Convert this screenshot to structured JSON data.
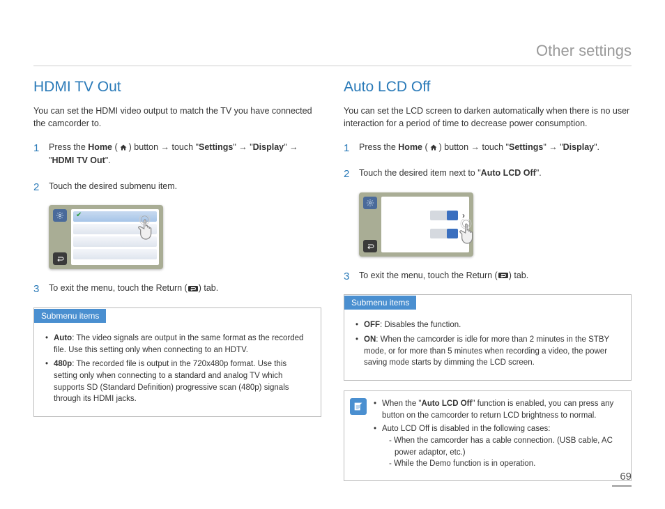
{
  "page": {
    "header": "Other settings",
    "number": "69"
  },
  "left": {
    "title": "HDMI TV Out",
    "intro": "You can set the HDMI video output to match the TV you have connected the camcorder to.",
    "step1_a": "Press the ",
    "step1_home": "Home",
    "step1_b": " (",
    "step1_c": ") button ",
    "arrow": "→",
    "step1_d": " touch \"",
    "step1_settings": "Settings",
    "step1_e": "\" ",
    "step1_f": " \"",
    "step1_display": "Display",
    "step1_g": "\" ",
    "step1_h": " \"",
    "step1_hdmi": "HDMI TV Out",
    "step1_i": "\".",
    "step2": "Touch the desired submenu item.",
    "step3_a": "To exit the menu, touch the Return (",
    "step3_b": ") tab.",
    "submenu_header": "Submenu items",
    "sub1_label": "Auto",
    "sub1_text": ": The video signals are output in the same format as the recorded file. Use this setting only when connecting to an HDTV.",
    "sub2_label": "480p",
    "sub2_text": ": The recorded file is output in the 720x480p format. Use this setting only when connecting to a standard and analog TV which supports SD (Standard Definition) progressive scan (480p) signals through its HDMI jacks."
  },
  "right": {
    "title": "Auto LCD Off",
    "intro": "You can set the LCD screen to darken automatically when there is no user interaction for a period of time to decrease power consumption.",
    "step1_a": "Press the ",
    "step1_home": "Home",
    "step1_b": " (",
    "step1_c": ") button ",
    "arrow": "→",
    "step1_d": " touch \"",
    "step1_settings": "Settings",
    "step1_e": "\" ",
    "step1_f": " \"",
    "step1_display": "Display",
    "step1_g": "\".",
    "step2_a": "Touch the desired item next to \"",
    "step2_b": "Auto LCD Off",
    "step2_c": "\".",
    "step3_a": "To exit the menu, touch the Return (",
    "step3_b": ") tab.",
    "submenu_header": "Submenu items",
    "sub1_label": "OFF",
    "sub1_text": ": Disables the function.",
    "sub2_label": "ON",
    "sub2_text": ": When the camcorder is idle for more than 2 minutes in the STBY mode, or for more than 5 minutes when recording a video, the power saving mode starts by dimming the LCD screen.",
    "note1_a": "When the \"",
    "note1_b": "Auto LCD Off",
    "note1_c": "\" function is enabled, you can press any button on the camcorder to return LCD brightness to normal.",
    "note2": "Auto LCD Off is disabled in the following cases:",
    "note2_s1": "- When the camcorder has a cable connection. (USB cable, AC power adaptor, etc.)",
    "note2_s2": "- While the Demo function is in operation."
  }
}
